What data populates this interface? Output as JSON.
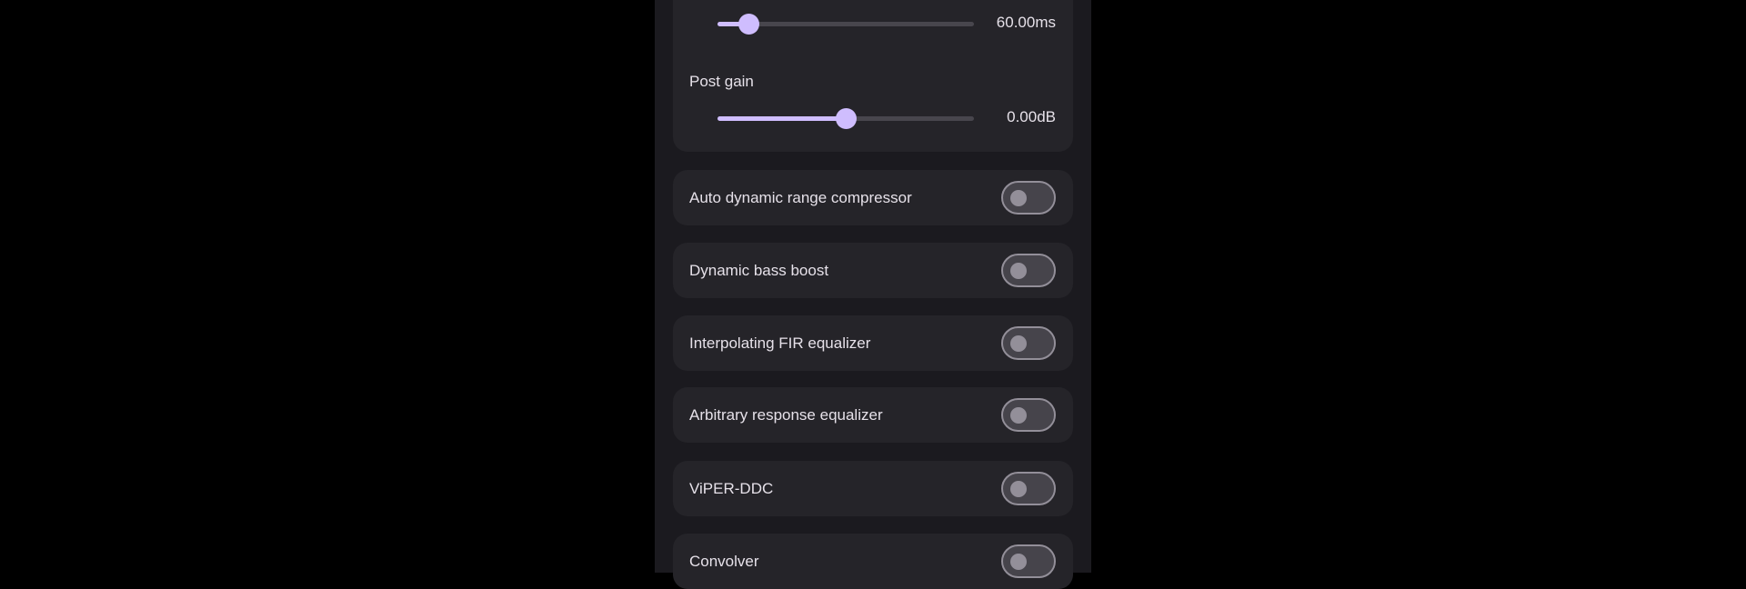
{
  "sliders": [
    {
      "label": "",
      "value_text": "60.00ms",
      "fraction": 0.12
    },
    {
      "label": "Post gain",
      "value_text": "0.00dB",
      "fraction": 0.5
    }
  ],
  "accent_color": "#cfbdfe",
  "toggles": [
    {
      "label": "Auto dynamic range compressor",
      "on": false
    },
    {
      "label": "Dynamic bass boost",
      "on": false
    },
    {
      "label": "Interpolating FIR equalizer",
      "on": false
    },
    {
      "label": "Arbitrary response equalizer",
      "on": false
    },
    {
      "label": "ViPER-DDC",
      "on": false
    },
    {
      "label": "Convolver",
      "on": false
    }
  ]
}
